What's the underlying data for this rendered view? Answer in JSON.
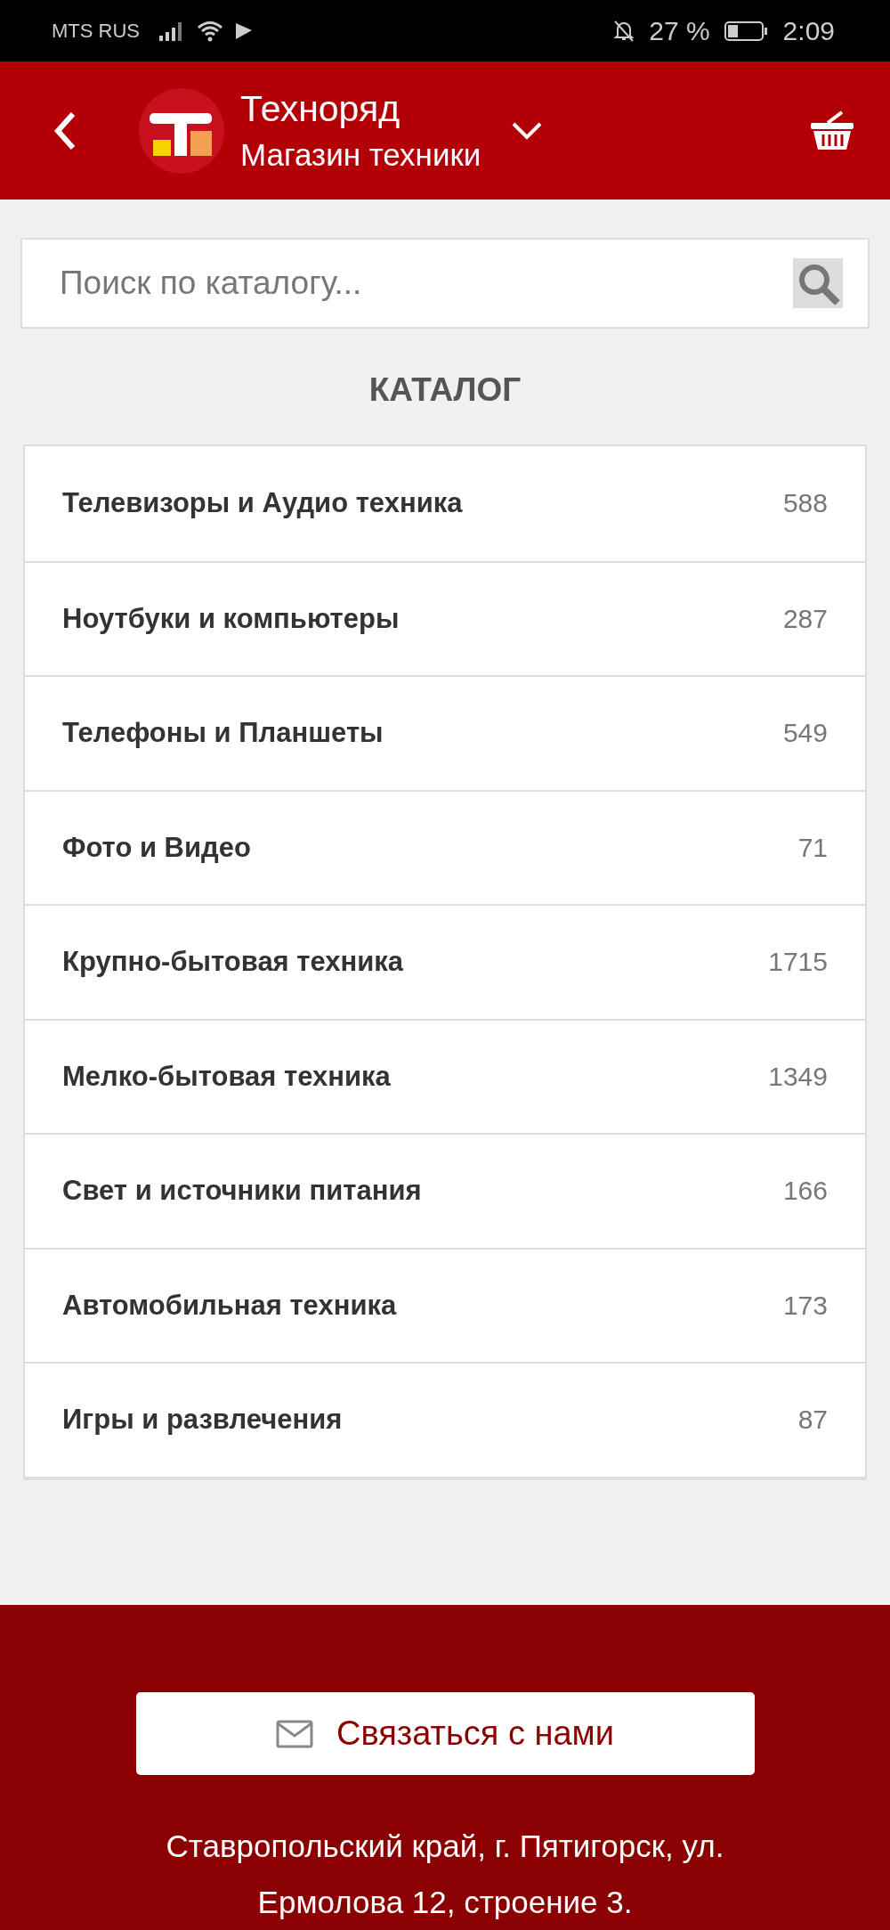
{
  "status_bar": {
    "carrier": "MTS RUS",
    "battery": "27 %",
    "time": "2:09"
  },
  "header": {
    "title": "Техноряд",
    "subtitle": "Магазин техники"
  },
  "search": {
    "placeholder": "Поиск по каталогу..."
  },
  "catalog": {
    "title": "КАТАЛОГ",
    "items": [
      {
        "name": "Телевизоры и Аудио техника",
        "count": "588"
      },
      {
        "name": "Ноутбуки и компьютеры",
        "count": "287"
      },
      {
        "name": "Телефоны и Планшеты",
        "count": "549"
      },
      {
        "name": "Фото и Видео",
        "count": "71"
      },
      {
        "name": "Крупно-бытовая техника",
        "count": "1715"
      },
      {
        "name": "Мелко-бытовая техника",
        "count": "1349"
      },
      {
        "name": "Свет и источники питания",
        "count": "166"
      },
      {
        "name": "Автомобильная техника",
        "count": "173"
      },
      {
        "name": "Игры и развлечения",
        "count": "87"
      }
    ]
  },
  "footer": {
    "contact_button": "Связаться с нами",
    "address": "Ставропольский край, г. Пятигорск, ул. Ермолова 12, строение 3."
  }
}
